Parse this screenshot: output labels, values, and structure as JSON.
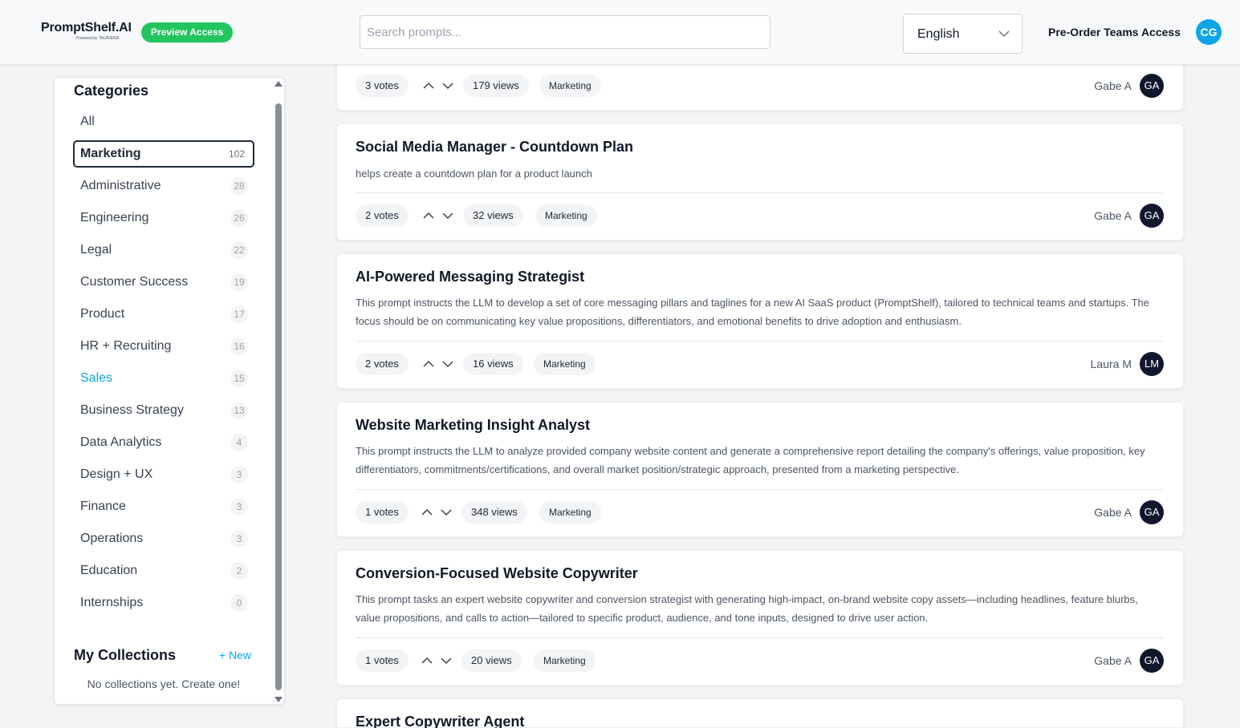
{
  "header": {
    "logo_text": "PromptShelf.AI",
    "logo_sub": "Powered by TALAVERA",
    "preview_badge": "Preview Access",
    "search_placeholder": "Search prompts...",
    "language": "English",
    "preorder_link": "Pre-Order Teams Access",
    "user_initials": "CG"
  },
  "sidebar": {
    "title": "Categories",
    "categories": [
      {
        "label": "All",
        "count": ""
      },
      {
        "label": "Marketing",
        "count": "102"
      },
      {
        "label": "Administrative",
        "count": "28"
      },
      {
        "label": "Engineering",
        "count": "26"
      },
      {
        "label": "Legal",
        "count": "22"
      },
      {
        "label": "Customer Success",
        "count": "19"
      },
      {
        "label": "Product",
        "count": "17"
      },
      {
        "label": "HR + Recruiting",
        "count": "16"
      },
      {
        "label": "Sales",
        "count": "15"
      },
      {
        "label": "Business Strategy",
        "count": "13"
      },
      {
        "label": "Data Analytics",
        "count": "4"
      },
      {
        "label": "Design + UX",
        "count": "3"
      },
      {
        "label": "Finance",
        "count": "3"
      },
      {
        "label": "Operations",
        "count": "3"
      },
      {
        "label": "Education",
        "count": "2"
      },
      {
        "label": "Internships",
        "count": "0"
      }
    ],
    "collections_title": "My Collections",
    "new_collection": "+ New",
    "collections_empty": "No collections yet. Create one!"
  },
  "prompts": [
    {
      "title": "",
      "description": "",
      "votes": "3 votes",
      "views": "179 views",
      "tag": "Marketing",
      "author": "Gabe A",
      "author_initials": "GA"
    },
    {
      "title": "Social Media Manager - Countdown Plan",
      "description": "helps create a countdown plan for a product launch",
      "votes": "2 votes",
      "views": "32 views",
      "tag": "Marketing",
      "author": "Gabe A",
      "author_initials": "GA"
    },
    {
      "title": "AI-Powered Messaging Strategist",
      "description": "This prompt instructs the LLM to develop a set of core messaging pillars and taglines for a new AI SaaS product (PromptShelf), tailored to technical teams and startups. The focus should be on communicating key value propositions, differentiators, and emotional benefits to drive adoption and enthusiasm.",
      "votes": "2 votes",
      "views": "16 views",
      "tag": "Marketing",
      "author": "Laura M",
      "author_initials": "LM"
    },
    {
      "title": "Website Marketing Insight Analyst",
      "description": "This prompt instructs the LLM to analyze provided company website content and generate a comprehensive report detailing the company's offerings, value proposition, key differentiators, commitments/certifications, and overall market position/strategic approach, presented from a marketing perspective.",
      "votes": "1 votes",
      "views": "348 views",
      "tag": "Marketing",
      "author": "Gabe A",
      "author_initials": "GA"
    },
    {
      "title": "Conversion-Focused Website Copywriter",
      "description": "This prompt tasks an expert website copywriter and conversion strategist with generating high-impact, on-brand website copy assets—including headlines, feature blurbs, value propositions, and calls to action—tailored to specific product, audience, and tone inputs, designed to drive user action.",
      "votes": "1 votes",
      "views": "20 views",
      "tag": "Marketing",
      "author": "Gabe A",
      "author_initials": "GA"
    },
    {
      "title": "Expert Copywriter Agent",
      "description": "",
      "votes": "",
      "views": "",
      "tag": "",
      "author": "",
      "author_initials": ""
    }
  ],
  "colors": {
    "accent": "#0ea5e9",
    "badge_green": "#22c55e",
    "avatar_dark": "#0f172a"
  },
  "icons": {
    "upvote": "chevron-up-icon",
    "downvote": "chevron-down-icon",
    "language_dropdown": "chevron-down-icon"
  }
}
